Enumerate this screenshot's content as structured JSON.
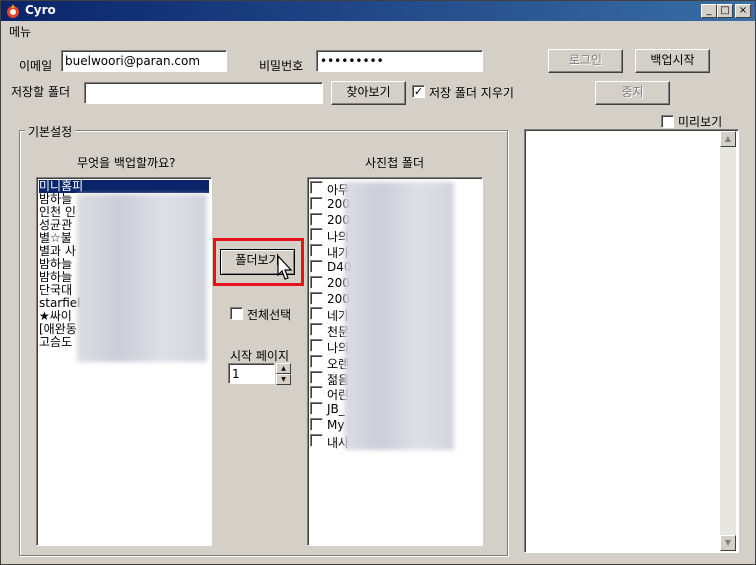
{
  "window": {
    "title": "Cyro"
  },
  "titlebar_buttons": {
    "minimize": "_",
    "maximize": "□",
    "close": "×"
  },
  "menu": {
    "items": [
      "메뉴"
    ]
  },
  "login": {
    "email_label": "이메일",
    "email_value": "buelwoori@paran.com",
    "password_label": "비밀번호",
    "password_value": "•••••••••",
    "login_button": "로그인",
    "start_button": "백업시작"
  },
  "save": {
    "folder_label": "저장할 폴더",
    "folder_value": "",
    "browse_button": "찾아보기",
    "clear_checkbox_label": "저장 폴더 지우기",
    "clear_checked": true,
    "stop_button": "중지"
  },
  "settings": {
    "group_label": "기본설정",
    "backup_question": "무엇을 백업할까요?",
    "album_folder_label": "사진첩 폴더",
    "folder_view_button": "폴더보기",
    "select_all_label": "전체선택",
    "start_page_label": "시작 페이지",
    "start_page_value": "1"
  },
  "preview": {
    "checkbox_label": "미리보기"
  },
  "homepages": [
    "미니홈피",
    "밤하늘",
    "인천 인",
    "성균관",
    "별☆불",
    "별과 사",
    "밤하늘",
    "밤하늘",
    "단국대",
    "starfiel",
    "★싸이",
    "[애완동",
    "고슴도"
  ],
  "album_folders": [
    "아무",
    "200",
    "200",
    "나의",
    "내가",
    "D40",
    "200",
    "200",
    "네가",
    "천문",
    "나의",
    "오렌",
    "젊음",
    "어린",
    "JB_",
    "My",
    "내사"
  ],
  "colors": {
    "selection": "#0a246a",
    "highlight": "#e8101a",
    "face": "#d4d0c8"
  }
}
